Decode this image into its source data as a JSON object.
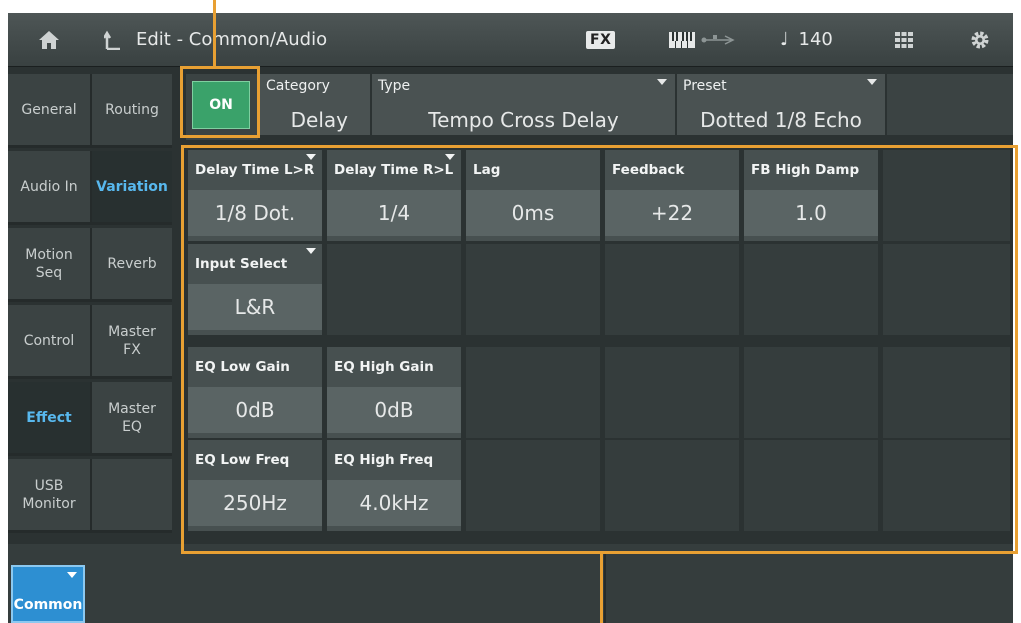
{
  "topbar": {
    "home_icon": "home-icon",
    "back_icon": "back-arrow-icon",
    "title": "Edit - Common/Audio",
    "fx_badge": "FX",
    "keyboard_icon": "keyboard-icon",
    "usb_icon": "usb-icon",
    "tempo_note": "♩",
    "tempo": "140",
    "grid_icon": "grid-icon",
    "settings_icon": "gear-icon"
  },
  "nav": {
    "col1": [
      "General",
      "Audio In",
      "Motion\nSeq",
      "Control",
      "Effect",
      "USB\nMonitor"
    ],
    "col2": [
      "Routing",
      "Variation",
      "Reverb",
      "Master\nFX",
      "Master\nEQ",
      ""
    ],
    "active_col1": "Effect",
    "active_col2": "Variation"
  },
  "header": {
    "switch_label": "ON",
    "category_label": "Category",
    "category_value": "Delay",
    "type_label": "Type",
    "type_value": "Tempo Cross Delay",
    "preset_label": "Preset",
    "preset_value": "Dotted 1/8 Echo"
  },
  "params": [
    {
      "label": "Delay Time L>R",
      "value": "1/8 Dot."
    },
    {
      "label": "Delay Time R>L",
      "value": "1/4"
    },
    {
      "label": "Lag",
      "value": "0ms"
    },
    {
      "label": "Feedback",
      "value": "+22"
    },
    {
      "label": "FB High Damp",
      "value": "1.0"
    },
    {
      "label": "Input Select",
      "value": "L&R"
    },
    {
      "label": "EQ Low Gain",
      "value": "0dB"
    },
    {
      "label": "EQ High Gain",
      "value": "0dB"
    },
    {
      "label": "EQ Low Freq",
      "value": "250Hz"
    },
    {
      "label": "EQ High Freq",
      "value": "4.0kHz"
    }
  ],
  "bottom": {
    "common_label": "Common"
  },
  "colors": {
    "accent_orange": "#e8a033",
    "switch_green": "#3aa26a",
    "active_blue": "#58b8ee",
    "common_tab": "#2d8fd2"
  }
}
